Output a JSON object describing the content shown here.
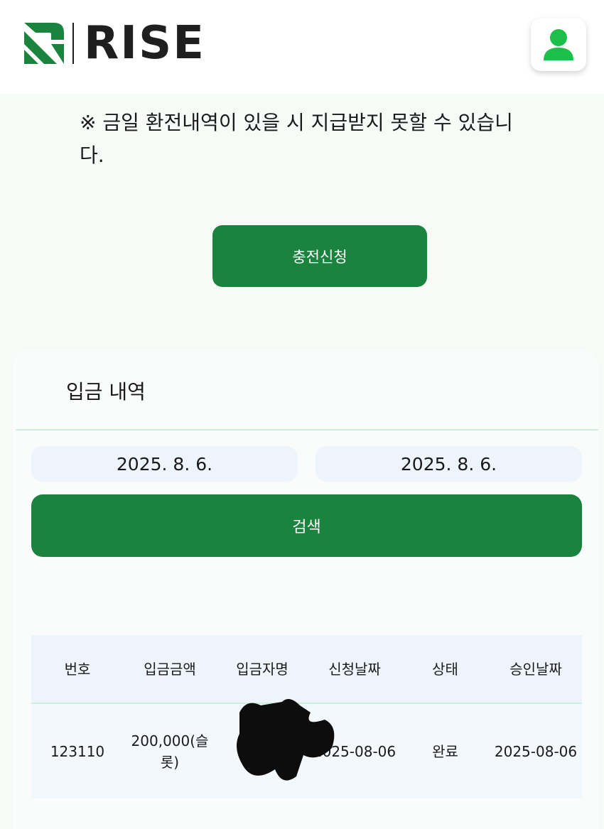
{
  "header": {
    "brand_name": "RISE",
    "brand_color": "#1a843f",
    "logo_icon": "rise-logo-icon",
    "profile_icon": "user-icon"
  },
  "notice": {
    "text": "※ 금일 환전내역이 있을 시 지급받지 못할 수 있습니다."
  },
  "apply_button": {
    "label": "충전신청"
  },
  "deposit_history": {
    "title": "입금 내역",
    "start_date": "2025. 8. 6.",
    "end_date": "2025. 8. 6.",
    "search_label": "검색",
    "columns": [
      "번호",
      "입금금액",
      "입금자명",
      "신청날짜",
      "상태",
      "승인날짜"
    ],
    "rows": [
      {
        "number": "123110",
        "amount": "200,000(슬롯)",
        "depositor": "",
        "request_date": "2025-08-06",
        "status": "완료",
        "approval_date": "2025-08-06"
      }
    ]
  }
}
